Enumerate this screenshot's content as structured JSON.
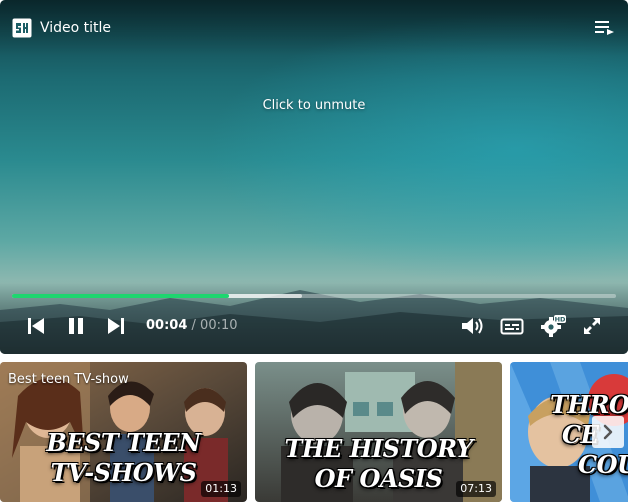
{
  "player": {
    "title": "Video title",
    "unmute_prompt": "Click to unmute",
    "logo_icon": "sh-logo-icon",
    "playlist_icon": "playlist-icon",
    "progress": {
      "played_fraction": 0.36,
      "buffered_fraction": 0.48
    },
    "time": {
      "current": "00:04",
      "separator": " / ",
      "total": "00:10"
    },
    "controls": {
      "previous_icon": "skip-previous-icon",
      "pause_icon": "pause-icon",
      "next_icon": "skip-next-icon",
      "volume_icon": "volume-icon",
      "captions_icon": "captions-icon",
      "settings_icon": "settings-hd-icon",
      "settings_badge": "HD",
      "fullscreen_icon": "fullscreen-icon"
    },
    "colors": {
      "progress_played": "#1ed66f"
    }
  },
  "related": {
    "heading": "Best teen TV-show",
    "items": [
      {
        "title_line1": "BEST TEEN",
        "title_line2": "TV-SHOWS",
        "duration": "01:13"
      },
      {
        "title_line1": "THE HISTORY",
        "title_line2": "OF OASIS",
        "duration": "07:13"
      },
      {
        "title_line1": "THROW",
        "title_line2": "CE",
        "title_line3": "COU"
      }
    ],
    "next_icon": "chevron-right-icon"
  }
}
